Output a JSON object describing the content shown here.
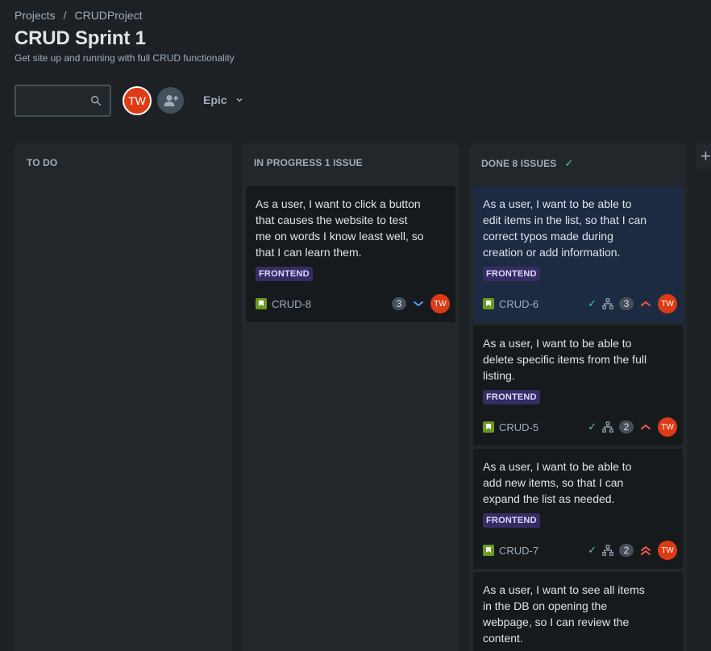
{
  "breadcrumb": {
    "items": [
      "Projects",
      "CRUDProject"
    ],
    "separator": "/"
  },
  "page": {
    "title": "CRUD Sprint 1",
    "subtitle": "Get site up and running with full CRUD functionality"
  },
  "toolbar": {
    "search_placeholder": "",
    "search_icon": "search-icon",
    "avatar_initials": "TW",
    "add_people_icon": "person-add-icon",
    "epic_label": "Epic"
  },
  "colors": {
    "background": "#1d2125",
    "column": "#22272b",
    "card": "#161a1d",
    "card_selected": "#1c2b41",
    "accent_avatar": "#dd3b16",
    "lozenge_bg": "#352c63",
    "story_green": "#6a9a23",
    "done_green": "#4bce97",
    "priority_high": "#f15b50",
    "priority_low": "#579dff"
  },
  "columns": {
    "todo": {
      "title": "TO DO"
    },
    "progress": {
      "title": "IN PROGRESS 1 ISSUE"
    },
    "done": {
      "title": "DONE 8 ISSUES",
      "check": "✓"
    }
  },
  "cards": {
    "crud8": {
      "summary": "As a user, I want to click a button that causes the website to test me on words I know least well, so that I can learn them.",
      "label": "FRONTEND",
      "key": "CRUD-8",
      "badge": "3",
      "priority": "low",
      "assignee": "TW"
    },
    "crud6": {
      "summary": "As a user, I want to be able to edit items in the list, so that I can correct typos made during creation or add information.",
      "label": "FRONTEND",
      "key": "CRUD-6",
      "done": "✓",
      "badge": "3",
      "priority": "high",
      "assignee": "TW"
    },
    "crud5": {
      "summary": "As a user, I want to be able to delete specific items from the full listing.",
      "label": "FRONTEND",
      "key": "CRUD-5",
      "done": "✓",
      "badge": "2",
      "priority": "high",
      "assignee": "TW"
    },
    "crud7": {
      "summary": "As a user, I want to be able to add new items, so that I can expand the list as needed.",
      "label": "FRONTEND",
      "key": "CRUD-7",
      "done": "✓",
      "badge": "2",
      "priority": "highest",
      "assignee": "TW"
    },
    "crud_next": {
      "summary": "As a user, I want to see all items in the DB on opening the webpage, so I can review the content."
    }
  },
  "add_column_label": "+"
}
